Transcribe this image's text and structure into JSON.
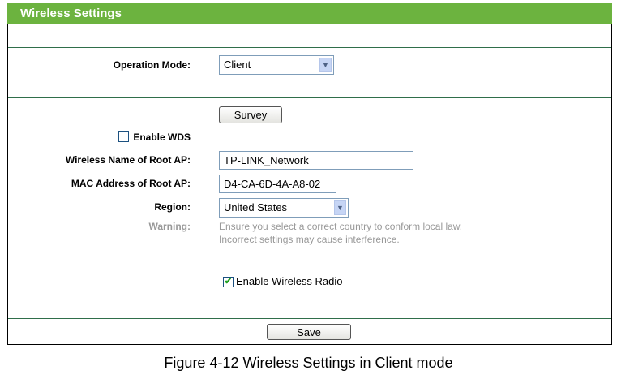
{
  "header": {
    "title": "Wireless Settings"
  },
  "operation_mode": {
    "label": "Operation Mode:",
    "value": "Client"
  },
  "survey_label": "Survey",
  "enable_wds": {
    "label": "Enable WDS",
    "checked": false
  },
  "root_ap_name": {
    "label": "Wireless Name of Root AP:",
    "value": "TP-LINK_Network"
  },
  "root_ap_mac": {
    "label": "MAC Address of Root AP:",
    "value": "D4-CA-6D-4A-A8-02"
  },
  "region": {
    "label": "Region:",
    "value": "United States"
  },
  "warning": {
    "label": "Warning:",
    "line1": "Ensure you select a correct country to conform local law.",
    "line2": "Incorrect settings may cause interference."
  },
  "enable_radio": {
    "label": "Enable Wireless Radio",
    "checked": true,
    "mark": "✔"
  },
  "save_label": "Save",
  "caption": "Figure 4-12 Wireless Settings in Client mode",
  "colors": {
    "header": "#6cb33f",
    "divider": "#2f6e4a"
  }
}
